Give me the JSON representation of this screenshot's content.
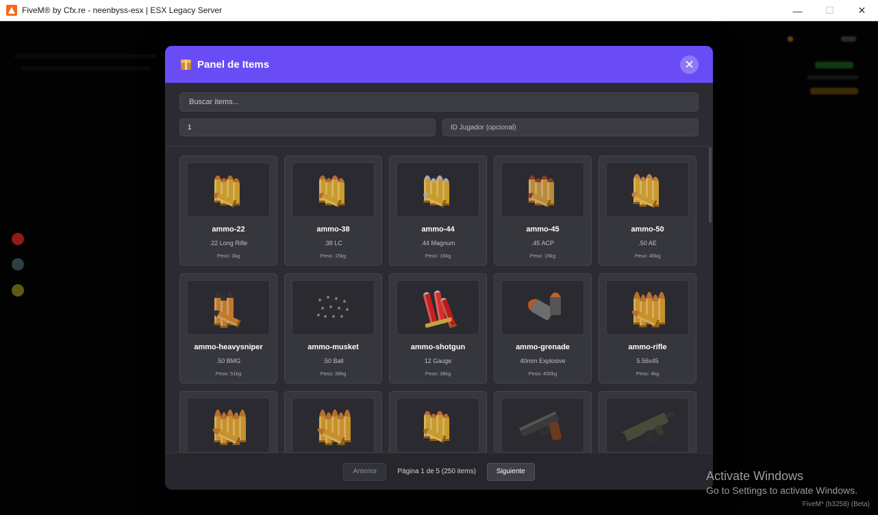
{
  "window": {
    "title": "FiveM® by Cfx.re - neenbyss-esx | ESX Legacy Server",
    "minimize": "—",
    "maximize": "☐",
    "close": "✕"
  },
  "modal": {
    "title": "Panel de Items",
    "close_glyph": "✕",
    "search_placeholder": "Buscar items...",
    "quantity_value": "1",
    "player_id_placeholder": "ID Jugador (opcional)"
  },
  "items": [
    {
      "name": "ammo-22",
      "desc": ".22 Long Rifle",
      "weight": "Peso: 3kg",
      "icon": "pistol-rounds-icon"
    },
    {
      "name": "ammo-38",
      "desc": ".38 LC",
      "weight": "Peso: 15kg",
      "icon": "pistol-rounds-icon"
    },
    {
      "name": "ammo-44",
      "desc": ".44 Magnum",
      "weight": "Peso: 16kg",
      "icon": "magnum-rounds-icon"
    },
    {
      "name": "ammo-45",
      "desc": ".45 ACP",
      "weight": "Peso: 15kg",
      "icon": "acp-rounds-icon"
    },
    {
      "name": "ammo-50",
      "desc": ".50 AE",
      "weight": "Peso: 45kg",
      "icon": "ae-rounds-icon"
    },
    {
      "name": "ammo-heavysniper",
      "desc": ".50 BMG",
      "weight": "Peso: 51kg",
      "icon": "sniper-rounds-icon"
    },
    {
      "name": "ammo-musket",
      "desc": ".50 Ball",
      "weight": "Peso: 38kg",
      "icon": "musket-balls-icon"
    },
    {
      "name": "ammo-shotgun",
      "desc": "12 Gauge",
      "weight": "Peso: 38kg",
      "icon": "shotgun-shells-icon"
    },
    {
      "name": "ammo-grenade",
      "desc": "40mm Explosive",
      "weight": "Peso: 400kg",
      "icon": "grenade-rounds-icon"
    },
    {
      "name": "ammo-rifle",
      "desc": "5.56x45",
      "weight": "Peso: 4kg",
      "icon": "rifle-rounds-icon"
    },
    {
      "name": "",
      "desc": "",
      "weight": "",
      "icon": "rifle-rounds-icon"
    },
    {
      "name": "",
      "desc": "",
      "weight": "",
      "icon": "rifle-rounds-icon"
    },
    {
      "name": "",
      "desc": "",
      "weight": "",
      "icon": "pistol-rounds-icon"
    },
    {
      "name": "",
      "desc": "",
      "weight": "",
      "icon": "pistol-icon"
    },
    {
      "name": "",
      "desc": "",
      "weight": "",
      "icon": "smg-icon"
    }
  ],
  "pagination": {
    "prev": "Anterior",
    "info": "Página 1 de 5 (250 items)",
    "next": "Siguiente"
  },
  "overlay": {
    "activate_title": "Activate Windows",
    "activate_sub": "Go to Settings to activate Windows.",
    "build": "FiveM* (b3258) (Beta)"
  },
  "colors": {
    "header_purple": "#6a4cf5",
    "modal_bg": "#2b2b31",
    "card_bg": "#36363d"
  }
}
